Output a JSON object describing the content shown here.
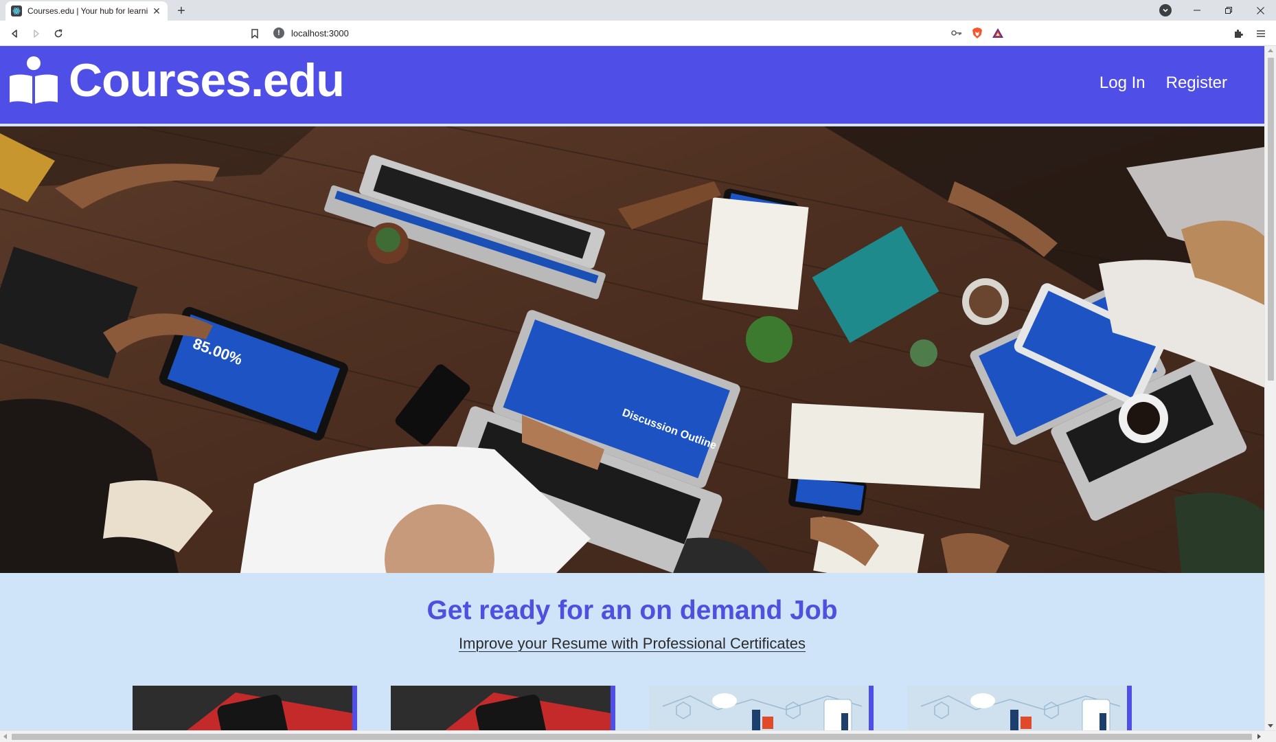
{
  "browser": {
    "tab_title": "Courses.edu | Your hub for learning",
    "url": "localhost:3000"
  },
  "site": {
    "logo_text": "Courses.edu",
    "nav": {
      "login": "Log In",
      "register": "Register"
    }
  },
  "hero": {
    "image": "team-meeting-laptops-photo",
    "tablet_text": "85.00%",
    "laptop_text": "Discussion Outline"
  },
  "promo": {
    "title": "Get ready for an on demand Job",
    "subtitle": "Improve your Resume with Professional Certificates"
  },
  "cards": [
    {
      "image": "phone-on-red-notebook"
    },
    {
      "image": "phone-on-red-notebook"
    },
    {
      "image": "tech-illustration"
    },
    {
      "image": "tech-illustration"
    }
  ],
  "colors": {
    "brand": "#4f4fe8",
    "page_background": "#cfe4f9",
    "title": "#4f4fe0"
  }
}
